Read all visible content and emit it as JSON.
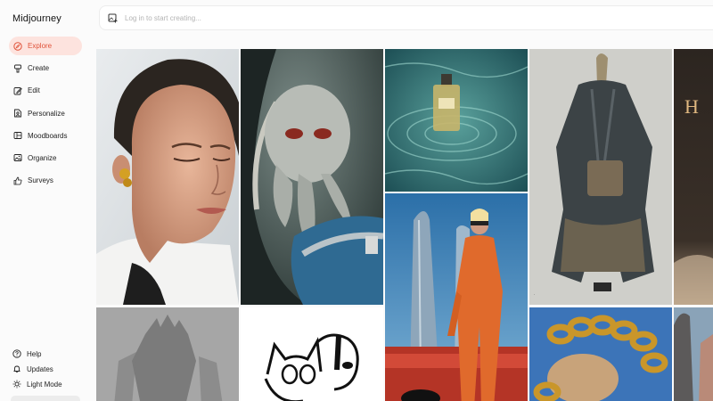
{
  "app": {
    "title": "Midjourney"
  },
  "nav": {
    "items": [
      {
        "label": "Explore",
        "icon": "compass-icon",
        "active": true
      },
      {
        "label": "Create",
        "icon": "brush-icon"
      },
      {
        "label": "Edit",
        "icon": "edit-icon"
      },
      {
        "label": "Personalize",
        "icon": "personalize-icon"
      },
      {
        "label": "Moodboards",
        "icon": "moodboard-icon"
      },
      {
        "label": "Organize",
        "icon": "image-icon"
      },
      {
        "label": "Surveys",
        "icon": "thumbs-up-icon"
      }
    ],
    "bottom": [
      {
        "label": "Help",
        "icon": "help-icon"
      },
      {
        "label": "Updates",
        "icon": "bell-icon"
      },
      {
        "label": "Light Mode",
        "icon": "sun-icon"
      }
    ]
  },
  "search": {
    "placeholder": "Log in to start creating..."
  },
  "gallery": {
    "tile_1": "portrait of woman with gold earring",
    "tile_2": "octopus creature in diving helmet",
    "tile_3": "perfume bottle in water",
    "tile_4": "woman in orange suit near skyscraper",
    "tile_5": "draped jacket on mannequin",
    "tile_6": "gold chain and lion",
    "tile_7": "robot in fog",
    "tile_8": "cat and dog line drawing",
    "tile_9": "partial letter H",
    "tile_10": "rocky cliff"
  },
  "colors": {
    "accent": "#e0533a",
    "accent_bg": "#fde3de"
  }
}
